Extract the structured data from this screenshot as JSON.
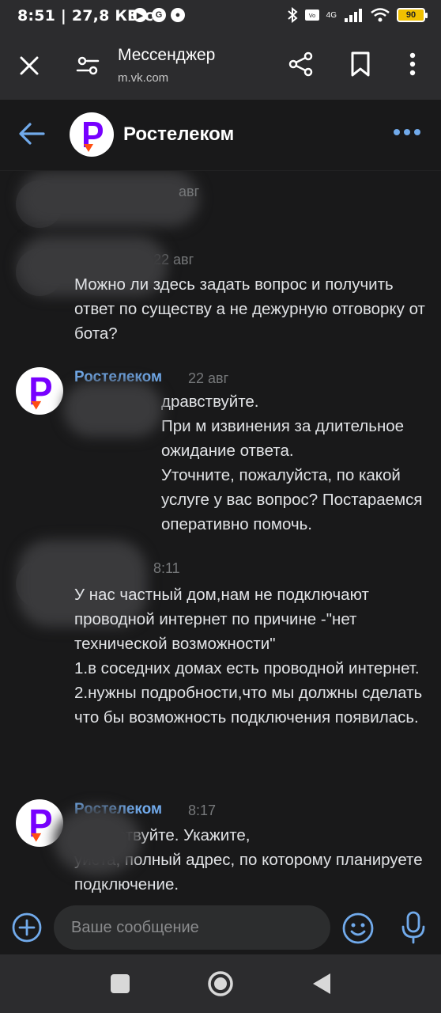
{
  "status_bar": {
    "time_speed": "8:51 | 27,8 КБ/с",
    "battery": "90",
    "network": "4G"
  },
  "browser": {
    "title": "Мессенджер",
    "url": "m.vk.com"
  },
  "chat": {
    "title": "Ростелеком"
  },
  "messages": [
    {
      "author": "",
      "time": "авг",
      "text": ""
    },
    {
      "author": "...",
      "time": "22 авг",
      "text": "Можно ли здесь задать вопрос и получить ответ по существу а не дежурную отговорку от бота?"
    },
    {
      "author": "Ростелеком",
      "time": "22 авг",
      "text": "дравствуйте.\nПри     м извинения за длительное ожидание ответа.\nУточните, пожалуйста, по какой услуге у вас вопрос? Постараемся оперативно помочь."
    },
    {
      "author": "",
      "time": "8:11",
      "text": "У нас частный дом,нам не подключают проводной интернет по причине -\"нет технической возможности\"\n1.в соседних домах есть проводной интернет.\n2.нужны подробности,что мы должны сделать что бы возможность подключения появилась."
    },
    {
      "author": "Ростелеком",
      "time": "8:17",
      "text": "здравствуйте. Укажите,\n      уйста, полный адрес, по которому планируете подключение."
    }
  ],
  "composer": {
    "placeholder": "Ваше сообщение"
  },
  "colors": {
    "background": "#19191a",
    "bar": "#2c2c2e",
    "accent": "#71aaeb",
    "brand": "#7700ff",
    "brand_secondary": "#ff4f12"
  }
}
